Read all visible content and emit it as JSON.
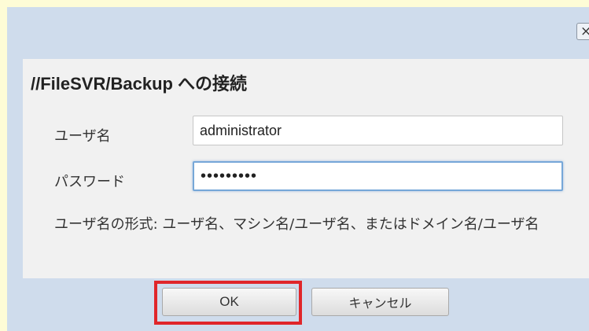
{
  "dialog": {
    "close_glyph": "×",
    "title": "//FileSVR/Backup への接続",
    "username_label": "ユーザ名",
    "username_value": "administrator",
    "password_label": "パスワード",
    "password_value": "•••••••••",
    "hint": "ユーザ名の形式: ユーザ名、マシン名/ユーザ名、またはドメイン名/ユーザ名",
    "ok_label": "OK",
    "cancel_label": "キャンセル"
  },
  "colors": {
    "background": "#fefcd6",
    "dialog": "#cfdcec",
    "content": "#f1f1f1",
    "highlight": "#e0262a",
    "focus": "#76a7d8"
  },
  "icons": {
    "close": "close-icon"
  }
}
